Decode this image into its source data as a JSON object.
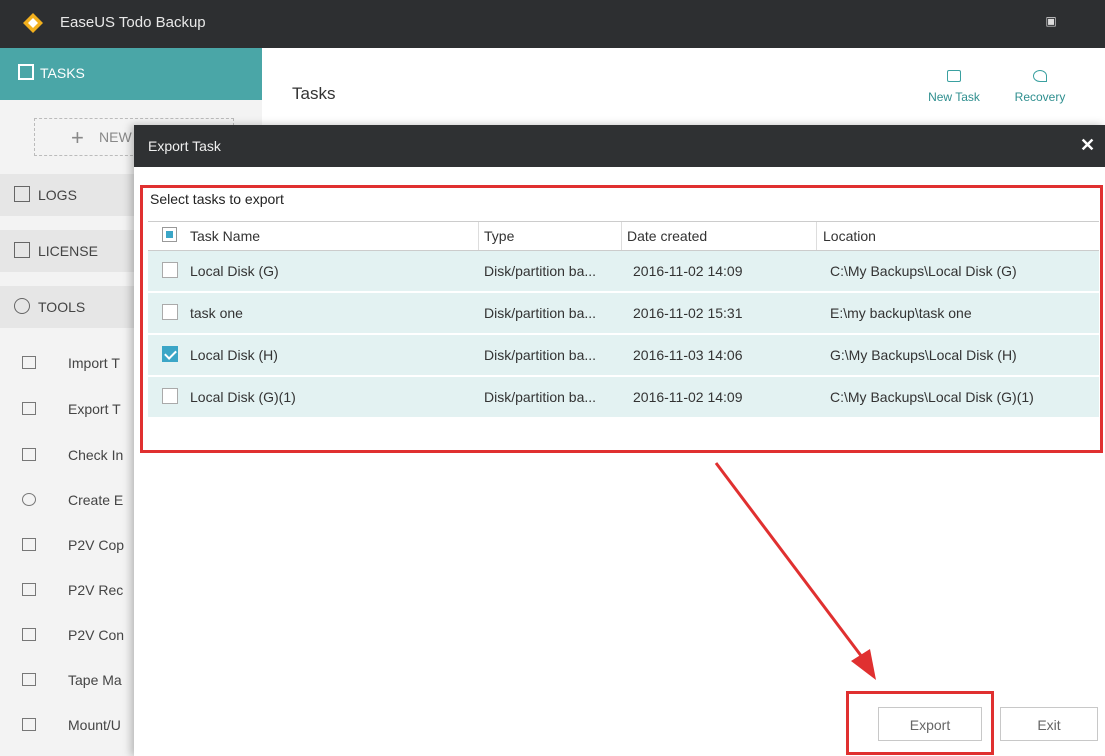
{
  "window": {
    "title": "EaseUS Todo Backup"
  },
  "sidebar": {
    "tasks_label": "TASKS",
    "new_label": "NEW",
    "logs_label": "LOGS",
    "license_label": "LICENSE",
    "tools_label": "TOOLS",
    "tool_items": [
      "Import T",
      "Export T",
      "Check In",
      "Create E",
      "P2V Cop",
      "P2V Rec",
      "P2V Con",
      "Tape Ma",
      "Mount/U"
    ]
  },
  "main": {
    "title": "Tasks",
    "actions": [
      {
        "label": "New Task",
        "icon": "new-task-icon"
      },
      {
        "label": "Recovery",
        "icon": "recovery-icon"
      }
    ]
  },
  "dialog": {
    "title": "Export Task",
    "select_label": "Select tasks to export",
    "columns": [
      "Task Name",
      "Type",
      "Date created",
      "Location"
    ],
    "rows": [
      {
        "checked": false,
        "name": "Local Disk (G)",
        "type": "Disk/partition ba...",
        "date": "2016-11-02 14:09",
        "location": "C:\\My Backups\\Local Disk (G)"
      },
      {
        "checked": false,
        "name": "task one",
        "type": "Disk/partition ba...",
        "date": "2016-11-02 15:31",
        "location": "E:\\my backup\\task one"
      },
      {
        "checked": true,
        "name": "Local Disk (H)",
        "type": "Disk/partition ba...",
        "date": "2016-11-03 14:06",
        "location": "G:\\My Backups\\Local Disk (H)"
      },
      {
        "checked": false,
        "name": "Local Disk (G)(1)",
        "type": "Disk/partition ba...",
        "date": "2016-11-02 14:09",
        "location": "C:\\My Backups\\Local Disk (G)(1)"
      }
    ],
    "export_label": "Export",
    "exit_label": "Exit",
    "annotation_color": "#e03030",
    "selection_color": "#3ba6c7"
  }
}
